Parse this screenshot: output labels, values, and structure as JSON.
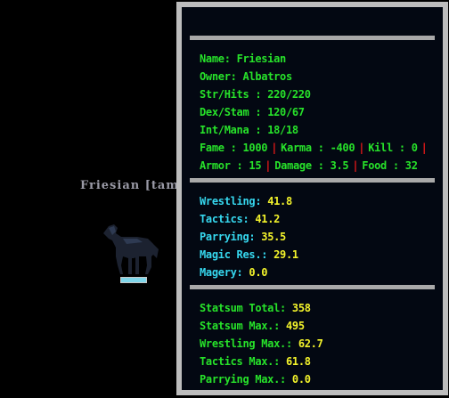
{
  "world": {
    "pet_label": "Friesian [tame"
  },
  "pet_health": 1.0,
  "panel": {
    "info": {
      "name_label": "Name:",
      "name_value": "Friesian",
      "owner_label": "Owner:",
      "owner_value": "Albatros",
      "strhits_label": "Str/Hits :",
      "strhits_value": "220/220",
      "dexstam_label": "Dex/Stam :",
      "dexstam_value": "120/67",
      "intmana_label": "Int/Mana :",
      "intmana_value": "18/18",
      "fame_label": "Fame :",
      "fame_value": "1000",
      "karma_label": "Karma :",
      "karma_value": "-400",
      "kill_label": "Kill :",
      "kill_value": "0",
      "armor_label": "Armor :",
      "armor_value": "15",
      "damage_label": "Damage :",
      "damage_value": "3.5",
      "food_label": "Food :",
      "food_value": "32",
      "separator": "|"
    },
    "skills": [
      {
        "label": "Wrestling:",
        "value": "41.8"
      },
      {
        "label": "Tactics:",
        "value": "41.2"
      },
      {
        "label": "Parrying:",
        "value": "35.5"
      },
      {
        "label": "Magic Res.:",
        "value": "29.1"
      },
      {
        "label": "Magery:",
        "value": "0.0"
      }
    ],
    "stats": [
      {
        "label": "Statsum Total:",
        "value": "358"
      },
      {
        "label": "Statsum Max.:",
        "value": "495"
      },
      {
        "label": "Wrestling Max.:",
        "value": "62.7"
      },
      {
        "label": "Tactics Max.:",
        "value": "61.8"
      },
      {
        "label": "Parrying Max.:",
        "value": "0.0"
      }
    ]
  },
  "colors": {
    "green_text": "#27e22a",
    "cyan_text": "#36d8ef",
    "yellow_text": "#f3f32b",
    "separator_red": "#e01818",
    "panel_frame": "#bdbdbd",
    "panel_bg": "#030812"
  }
}
